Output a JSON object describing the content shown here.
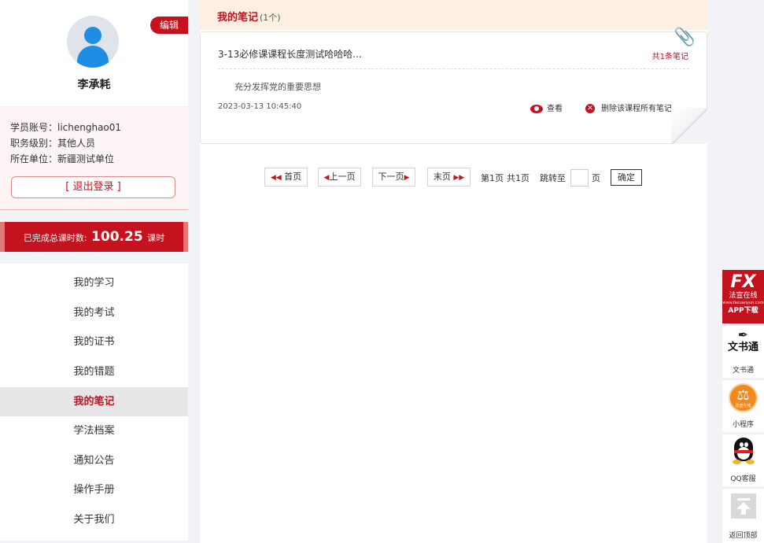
{
  "colors": {
    "accent": "#c5121f",
    "header_bg": "#fdf0e2",
    "page_bg": "#f2f3f7"
  },
  "profile": {
    "edit_label": "编辑",
    "name": "李承耗",
    "account": "学员账号：lichenghao01",
    "level": "职务级别：其他人员",
    "unit": "所在单位：新疆测试单位",
    "logout_label": "[ 退出登录 ]"
  },
  "hours": {
    "prefix": "已完成总课时数:",
    "value": "100.25",
    "suffix": "课时"
  },
  "menu": [
    {
      "label": "我的学习",
      "active": false
    },
    {
      "label": "我的考试",
      "active": false
    },
    {
      "label": "我的证书",
      "active": false
    },
    {
      "label": "我的错题",
      "active": false
    },
    {
      "label": "我的笔记",
      "active": true
    },
    {
      "label": "学法档案",
      "active": false
    },
    {
      "label": "通知公告",
      "active": false
    },
    {
      "label": "操作手册",
      "active": false
    },
    {
      "label": "关于我们",
      "active": false
    }
  ],
  "notes": {
    "title": "我的笔记",
    "count": "(1个)",
    "items": [
      {
        "course": "3-13必修课课程长度测试哈哈哈...",
        "total": "共1条笔记",
        "note": "充分发挥党的重要思想",
        "date": "2023-03-13 10:45:40",
        "view_label": "查看",
        "delete_label": "删除该课程所有笔记"
      }
    ]
  },
  "pager": {
    "first": "首页",
    "prev": "上一页",
    "next": "下一页",
    "last": "末页",
    "current": "第1页",
    "total": "共1页",
    "jump_label": "跳转至",
    "page_unit": "页",
    "confirm": "确定",
    "jump_value": ""
  },
  "toolbar": {
    "app_logo": "FX",
    "app_name": "法宣在线",
    "app_url": "www.faxuanyun.com",
    "app_download": "APP下载",
    "wenshu_title": "文书通",
    "wenshu_label": "文书通",
    "miniapp_badge": "法宣在线",
    "miniapp_label": "小程序",
    "qq_label": "QQ客服",
    "top_label": "返回顶部"
  }
}
